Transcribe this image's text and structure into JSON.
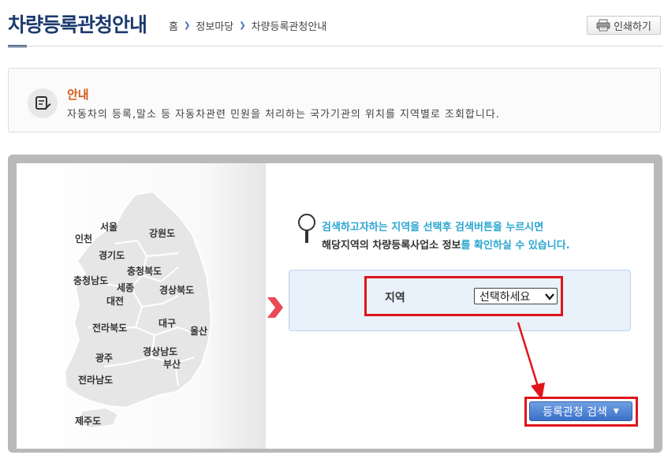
{
  "header": {
    "title": "차량등록관청안내",
    "breadcrumb": [
      "홈",
      "정보마당",
      "차량등록관청안내"
    ],
    "print_label": "인쇄하기",
    "print_icon": "printer-icon"
  },
  "notice": {
    "icon": "notepad-pencil-icon",
    "title": "안내",
    "text": "자동차의 등록,말소 등 자동차관련 민원을 처리하는 국가기관의 위치를 지역별로 조회합니다."
  },
  "map": {
    "regions": [
      "서울",
      "인천",
      "강원도",
      "경기도",
      "충청북도",
      "충청남도",
      "세종",
      "대전",
      "경상북도",
      "전라북도",
      "대구",
      "울산",
      "광주",
      "경상남도",
      "부산",
      "전라남도",
      "제주도"
    ]
  },
  "guide": {
    "icon": "magnifier-icon",
    "line1": "검색하고자하는 지역을 선택후 검색버튼을 누르시면",
    "line2_prefix": "해당지역의 차량등록사업소 정보",
    "line2_suffix": "를 확인하실 수 있습니다."
  },
  "search_form": {
    "region_label": "지역",
    "region_select_value": "선택하세요",
    "search_button_label": "등록관청 검색"
  },
  "colors": {
    "title": "#1b3a6e",
    "notice_title": "#d4581a",
    "guide_highlight": "#2aa6d0",
    "annotation_red": "#e0141b",
    "button_blue": "#3a70c8"
  }
}
